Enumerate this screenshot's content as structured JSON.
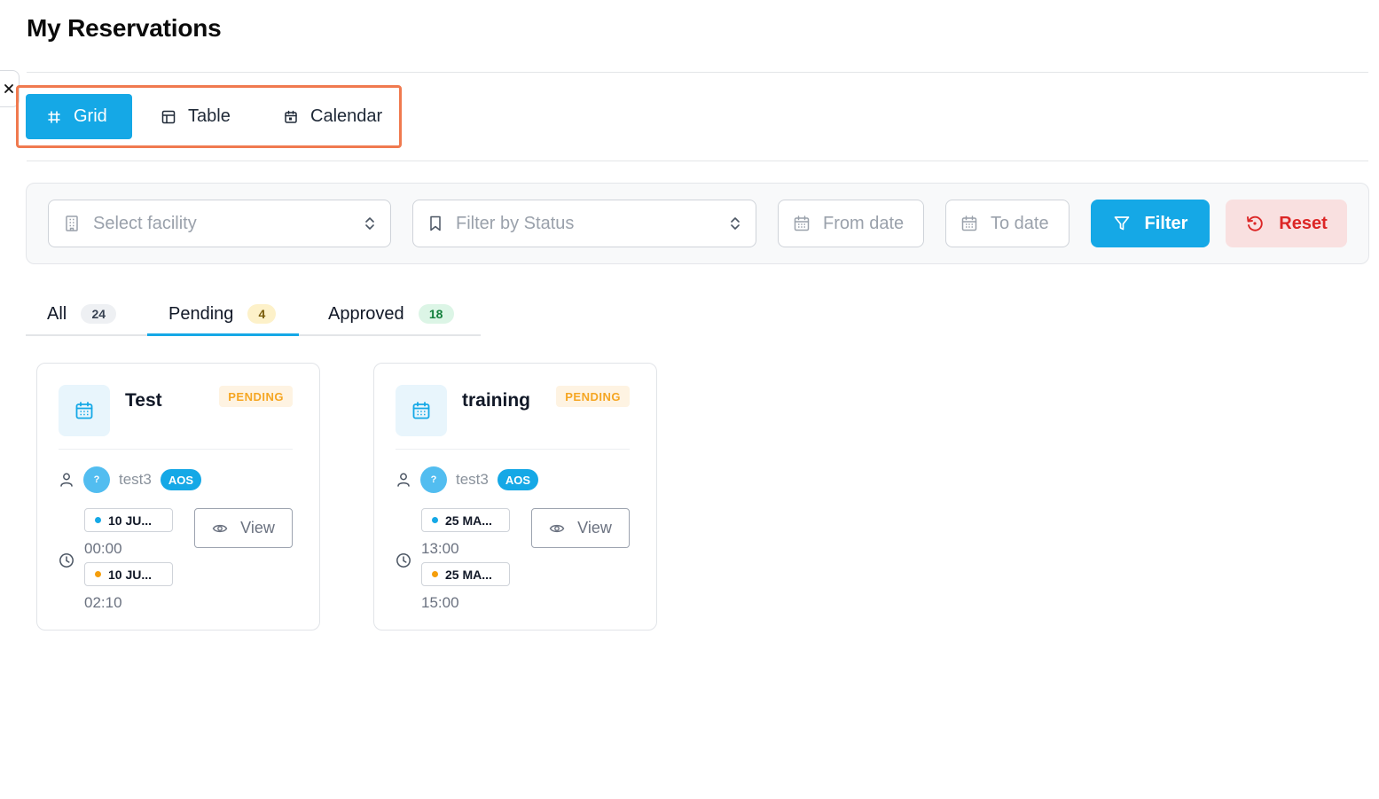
{
  "page": {
    "title": "My Reservations"
  },
  "view_switcher": {
    "options": [
      {
        "label": "Grid",
        "icon": "hash-icon",
        "active": true
      },
      {
        "label": "Table",
        "icon": "table-icon",
        "active": false
      },
      {
        "label": "Calendar",
        "icon": "calendar-icon",
        "active": false
      }
    ]
  },
  "filters": {
    "facility_placeholder": "Select facility",
    "status_placeholder": "Filter by Status",
    "from_date_placeholder": "From date",
    "to_date_placeholder": "To date",
    "filter_label": "Filter",
    "reset_label": "Reset"
  },
  "tabs": [
    {
      "label": "All",
      "count": "24",
      "active": false
    },
    {
      "label": "Pending",
      "count": "4",
      "active": true
    },
    {
      "label": "Approved",
      "count": "18",
      "active": false
    }
  ],
  "reservations": [
    {
      "title": "Test",
      "status": "PENDING",
      "user_initial": "?",
      "user": "test3",
      "department": "AOS",
      "start_date": "10 JU...",
      "start_time": "00:00",
      "end_date": "10 JU...",
      "end_time": "02:10",
      "view_label": "View"
    },
    {
      "title": "training",
      "status": "PENDING",
      "user_initial": "?",
      "user": "test3",
      "department": "AOS",
      "start_date": "25 MA...",
      "start_time": "13:00",
      "end_date": "25 MA...",
      "end_time": "15:00",
      "view_label": "View"
    }
  ],
  "colors": {
    "accent": "#15a8e6",
    "highlight_border": "#f07a4f",
    "pending": "#f5a623",
    "reset_text": "#dc2626",
    "reset_bg": "#f9e0e0"
  }
}
